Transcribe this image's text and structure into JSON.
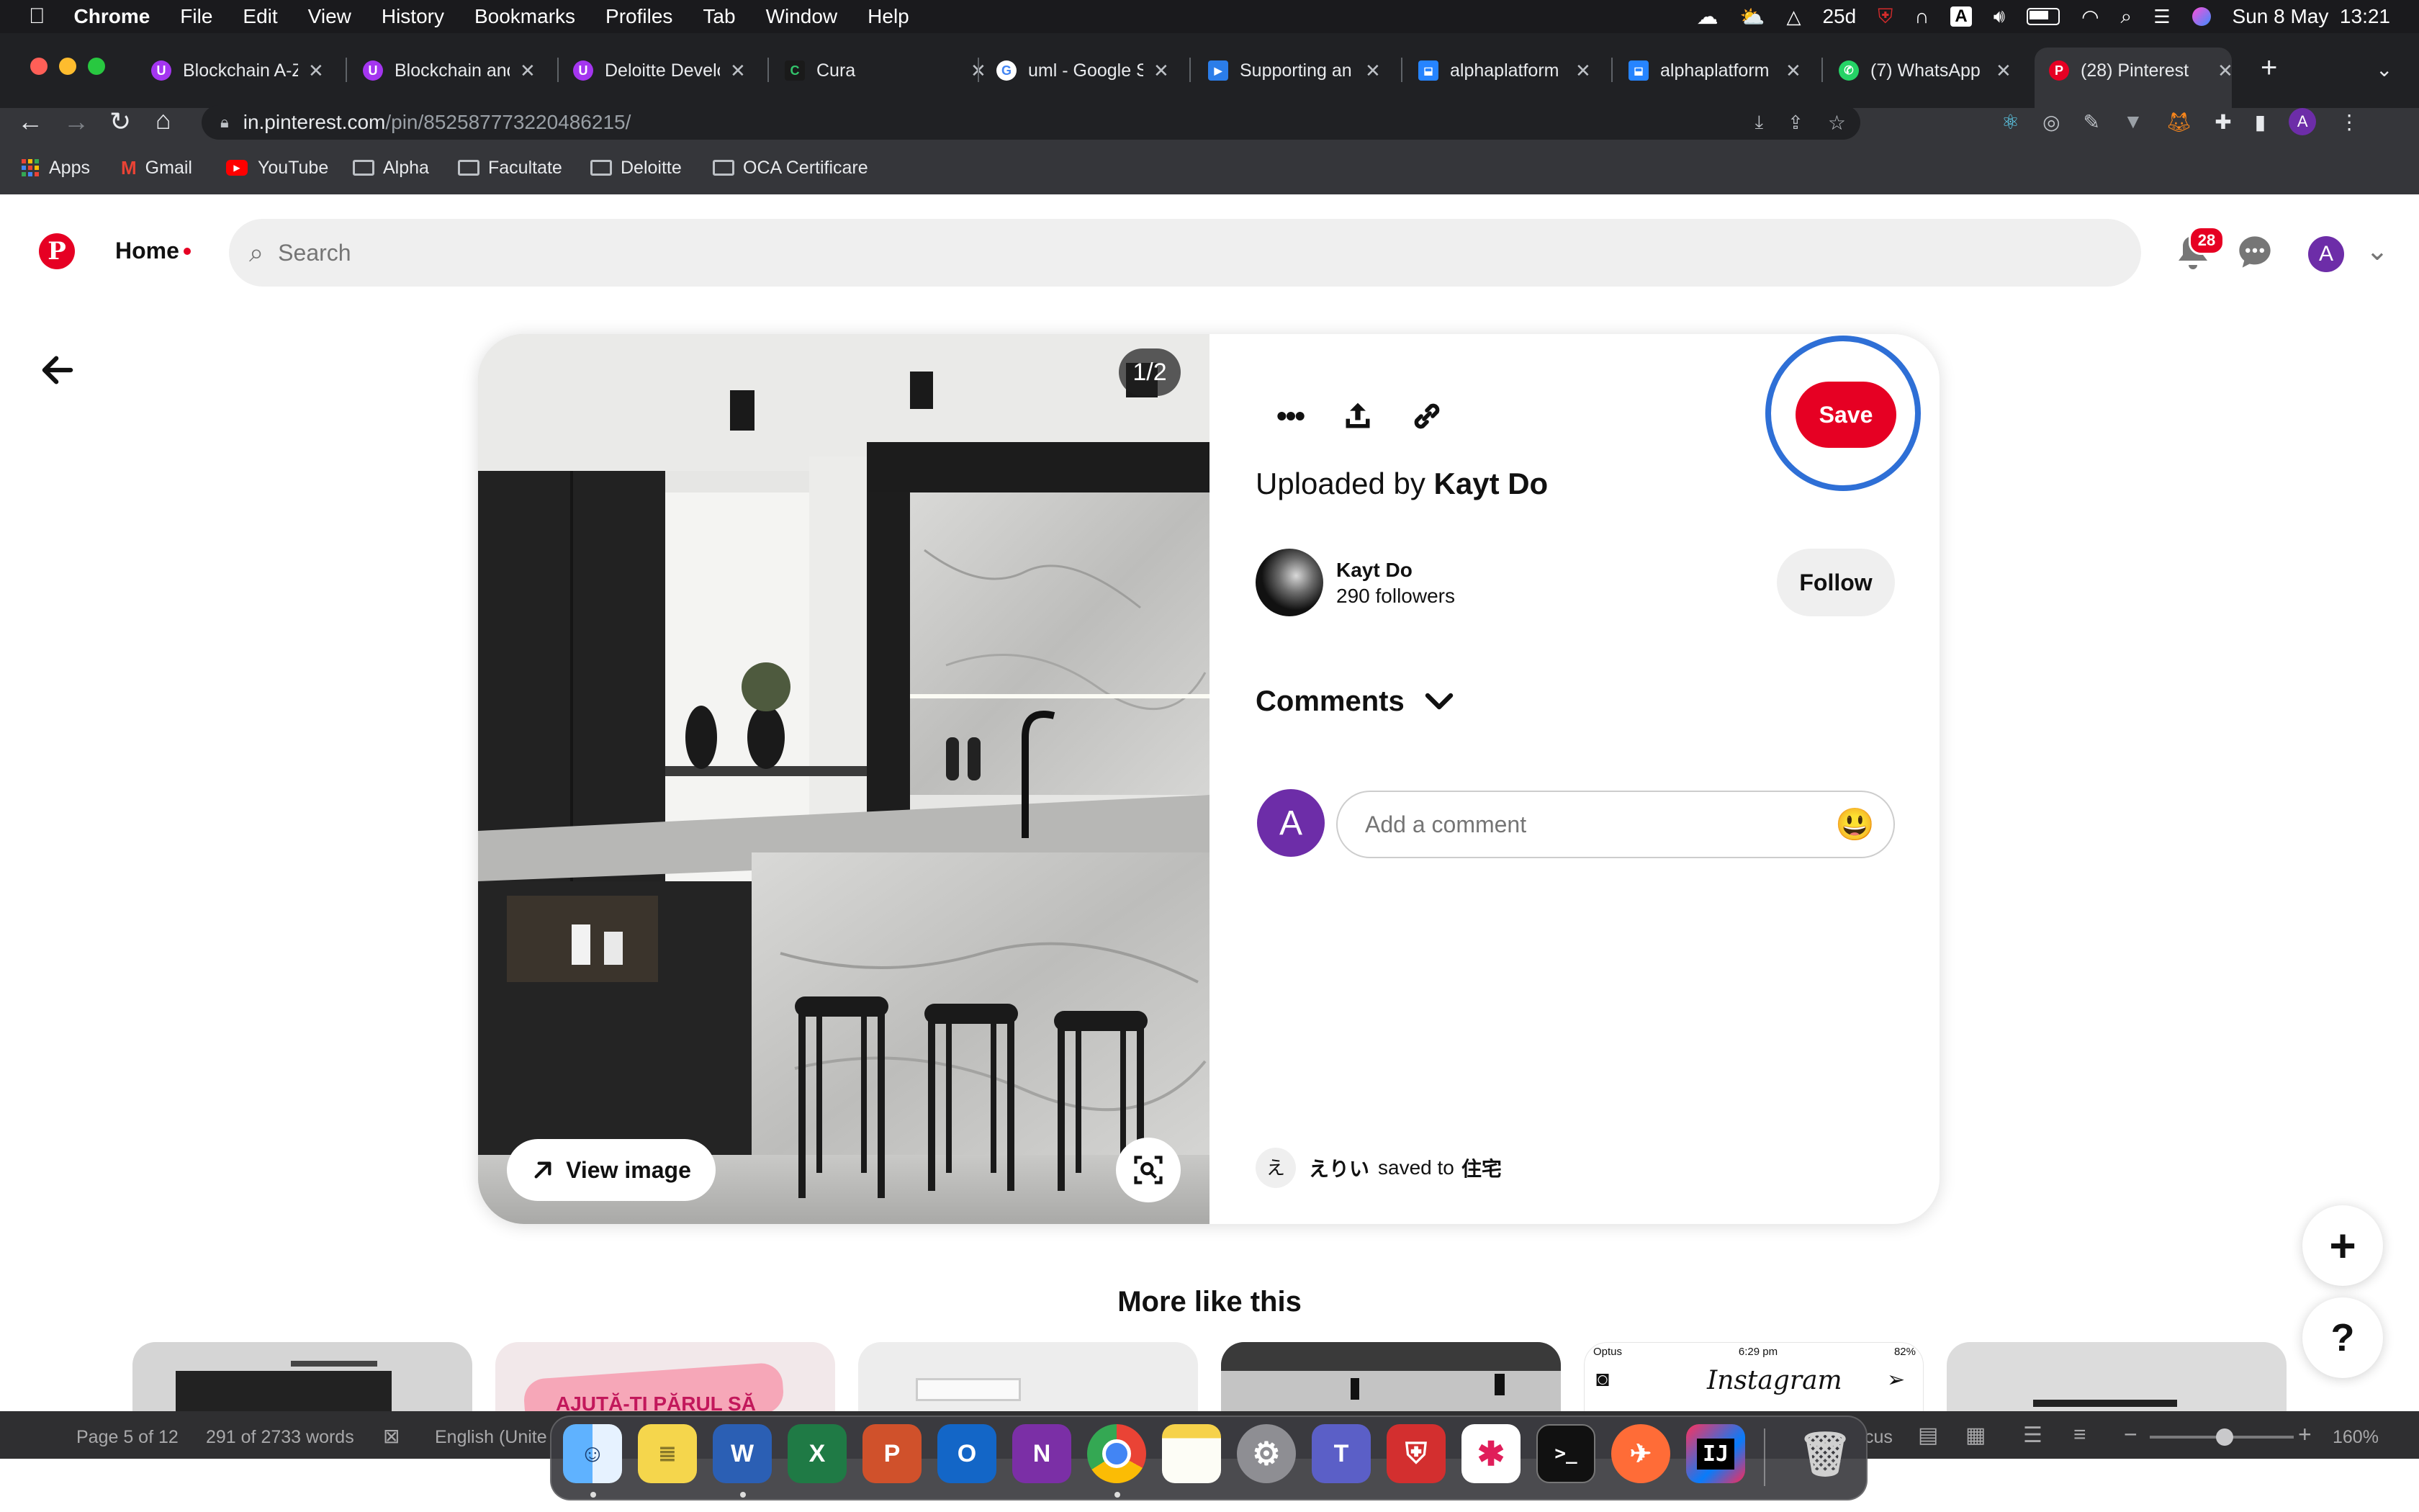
{
  "menubar": {
    "app": "Chrome",
    "items": [
      "File",
      "Edit",
      "View",
      "History",
      "Bookmarks",
      "Profiles",
      "Tab",
      "Window",
      "Help"
    ],
    "status_25d": "25d",
    "datetime": "Sun 8 May  13:21"
  },
  "tabs": [
    {
      "title": "Blockchain A-Z",
      "icon": "udemy-icon",
      "color": "#a435f0",
      "glyph": "U"
    },
    {
      "title": "Blockchain and",
      "icon": "udemy-icon",
      "color": "#a435f0",
      "glyph": "U"
    },
    {
      "title": "Deloitte Develo",
      "icon": "udemy-icon",
      "color": "#a435f0",
      "glyph": "U"
    },
    {
      "title": "Cura",
      "icon": "cura-icon",
      "color": "#1a1a1a",
      "glyph": "C"
    },
    {
      "title": "uml - Google S",
      "icon": "google-icon",
      "color": "#ffffff",
      "glyph": "G"
    },
    {
      "title": "Supporting an",
      "icon": "video-icon",
      "color": "#2b7de9",
      "glyph": "▶"
    },
    {
      "title": "alphaplatform",
      "icon": "bitbucket-icon",
      "color": "#2684ff",
      "glyph": "⬓"
    },
    {
      "title": "alphaplatform",
      "icon": "bitbucket-icon",
      "color": "#2684ff",
      "glyph": "⬓"
    },
    {
      "title": "(7) WhatsApp",
      "icon": "whatsapp-icon",
      "color": "#25d366",
      "glyph": "✆"
    },
    {
      "title": "(28) Pinterest",
      "icon": "pinterest-icon",
      "color": "#e60023",
      "glyph": "P"
    }
  ],
  "url": {
    "domain": "in.pinterest.com",
    "path": "/pin/852587773220486215/"
  },
  "bookmarks": [
    "Apps",
    "Gmail",
    "YouTube",
    "Alpha",
    "Facultate",
    "Deloitte",
    "OCA Certificare"
  ],
  "pinterest": {
    "home_label": "Home",
    "search_placeholder": "Search",
    "notif_count": "28",
    "avatar_letter": "A",
    "pin": {
      "counter": "1/2",
      "view_image": "View image",
      "save": "Save",
      "uploaded_by_prefix": "Uploaded by",
      "uploader": "Kayt Do",
      "creator_name": "Kayt Do",
      "creator_followers": "290 followers",
      "follow": "Follow",
      "comments_title": "Comments",
      "comment_avatar": "A",
      "comment_placeholder": "Add a comment",
      "emoji": "😃",
      "saved_avatar": "え",
      "saved_user": "えりい",
      "saved_to_text": "saved to",
      "saved_board": "住宅"
    },
    "more_like_this": "More like this",
    "thumb2_text": "AJUTĂ-ȚI PĂRUL SĂ",
    "thumb5": {
      "carrier": "Optus",
      "time": "6:29 pm",
      "battery": "82%",
      "app": "Instagram"
    }
  },
  "wordbar": {
    "page": "Page 5 of 12",
    "words": "291 of 2733 words",
    "language": "English (Unite",
    "focus_fragment": "cus",
    "zoom": "160%"
  },
  "dock": [
    "finder-icon",
    "notes-icon",
    "word-icon",
    "excel-icon",
    "powerpoint-icon",
    "outlook-icon",
    "onenote-icon",
    "chrome-icon",
    "notes-yellow-icon",
    "system-preferences-icon",
    "teams-icon",
    "vpn-icon",
    "slack-icon",
    "terminal-icon",
    "postman-icon",
    "intellij-icon",
    "trash-icon"
  ]
}
